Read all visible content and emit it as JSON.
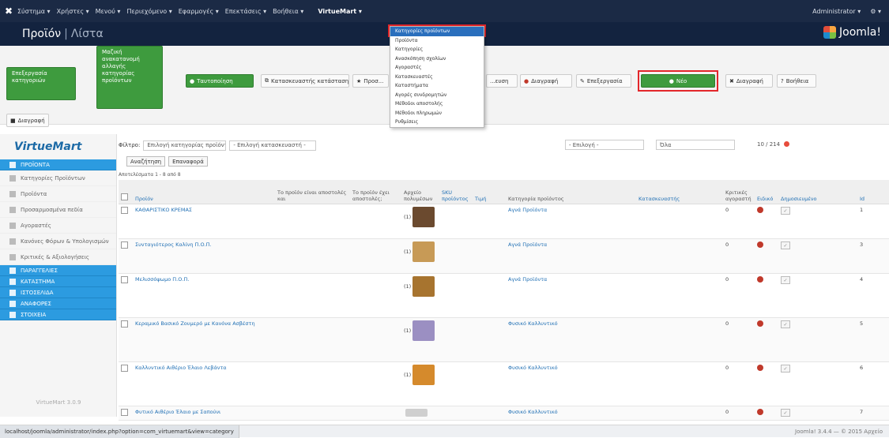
{
  "topnav": {
    "menus": [
      "Σύστημα ▾",
      "Χρήστες ▾",
      "Μενού ▾",
      "Περιεχόμενο ▾",
      "Εφαρμογές ▾",
      "Επεκτάσεις ▾",
      "Βοήθεια ▾"
    ],
    "active_menu": "VirtueMart ▾",
    "right": [
      "Administrator ▾",
      "⚙ ▾"
    ]
  },
  "header": {
    "title": "Προϊόν",
    "subtitle": "Λίστα"
  },
  "brand": {
    "logo_text": "Joomla!"
  },
  "toolbar": {
    "b1": "Επεξεργασία κατηγοριών",
    "b2": "Μαζική ανακατανομή αλλαγής κατηγορίας προϊόντων",
    "b3": "Ταυτοποίηση",
    "b4": "Κατασκευαστής κατάστασης",
    "b5": "Προσ...",
    "b6": "...ευση",
    "b7": "Διαγραφή",
    "b8": "Επεξεργασία",
    "b9": "Νέο",
    "b10": "Διαγραφή",
    "b11": "Βοήθεια",
    "b12": "Διαγραφή"
  },
  "dropdown": {
    "items": [
      "Κατηγορίες προϊόντων",
      "Προϊόντα",
      "Κατηγορίες",
      "Ανασκόπηση σχολίων",
      "Αγοραστές",
      "Κατασκευαστές",
      "Καταστήματα",
      "Αγορές συνδρομητών",
      "Μέθοδοι αποστολής",
      "Μέθοδοι πληρωμών",
      "Ρυθμίσεις"
    ]
  },
  "sidebar": {
    "logo": "VirtueMart",
    "sections": [
      {
        "label": "ΠΡΟΪΟΝΤΑ",
        "type": "section"
      },
      {
        "label": "Κατηγορίες Προϊόντων",
        "type": "item"
      },
      {
        "label": "Προϊόντα",
        "type": "item"
      },
      {
        "label": "Προσαρμοσμένα πεδία",
        "type": "item"
      },
      {
        "label": "Αγοραστές",
        "type": "item"
      },
      {
        "label": "Κανόνες Φόρων & Υπολογισμών",
        "type": "item"
      },
      {
        "label": "Κριτικές & Αξιολογήσεις",
        "type": "item"
      },
      {
        "label": "ΠΑΡΑΓΓΕΛΙΕΣ",
        "type": "section"
      },
      {
        "label": "ΚΑΤΑΣΤΗΜΑ",
        "type": "section"
      },
      {
        "label": "ΙΣΤΟΣΕΛΙΔΑ",
        "type": "section"
      },
      {
        "label": "ΑΝΑΦΟΡΕΣ",
        "type": "section"
      },
      {
        "label": "ΣΤΟΙΧΕΙΑ",
        "type": "section"
      }
    ],
    "version": "VirtueMart 3.0.9"
  },
  "filters": {
    "label": "Φίλτρο:",
    "cat": "Επιλογή κατηγορίας προϊόντος",
    "mfr": "- Επιλογή κατασκευαστή -",
    "sel3": "- Επιλογή -",
    "sel4": "Όλα",
    "reset": "Επαναφορά",
    "go": "Αναζήτηση",
    "count": "10 / 214"
  },
  "pager": "Αποτελέσματα 1 - 8 από 8",
  "table": {
    "headers": [
      "",
      "Προϊόν",
      "Το προϊόν είναι αποστολές και",
      "Το προϊόν έχει αποστολές;",
      "Αρχείο πολυμέσων",
      "SKU προϊόντος",
      "Τιμή",
      "Κατηγορία προϊόντος",
      "Κατασκευαστής",
      "Κριτικές αγοραστή",
      "Ειδικό",
      "Δημοσιευμένο",
      "Id"
    ],
    "rows": [
      {
        "name": "ΚΑΘΑΡΙΣΤΙΚΟ ΚΡΕΜΑΣ",
        "img": "(1)",
        "cat": "Αγνά Προϊόντα",
        "reviews": "0",
        "id": "1",
        "thumb": "#6b4a2f"
      },
      {
        "name": "Συνταγιότερος Καλίνη Π.Ο.Π.",
        "img": "(1)",
        "cat": "Αγνά Προϊόντα",
        "reviews": "0",
        "id": "3",
        "thumb": "#c79a56"
      },
      {
        "name": "Μελισσόψωμο Π.Ο.Π.",
        "img": "(1)",
        "cat": "Αγνά Προϊόντα",
        "reviews": "0",
        "id": "4",
        "thumb": "#a7742f"
      },
      {
        "name": "Κεραμικό Βασικό Ζουμερό με Κανόνα Ασβέστη",
        "img": "(1)",
        "cat": "Φυσικό Καλλυντικό",
        "reviews": "0",
        "id": "5",
        "thumb": "#9b8fc2"
      },
      {
        "name": "Καλλυντικό Αιθέριο Έλαιο Λεβάντα",
        "img": "(1)",
        "cat": "Φυσικό Καλλυντικό",
        "reviews": "0",
        "id": "6",
        "thumb": "#d58a2c"
      },
      {
        "name": "Φυτικό Αιθέριο Έλαιο με Σαπούνι",
        "img": "",
        "cat": "Φυσικό Καλλυντικό",
        "reviews": "0",
        "id": "7",
        "thumb": "#cfcfcf"
      }
    ]
  },
  "status": {
    "url": "localhost/joomla/administrator/index.php?option=com_virtuemart&view=category",
    "copyright": "Joomla! 3.4.4 — © 2015 Αρχείο"
  }
}
